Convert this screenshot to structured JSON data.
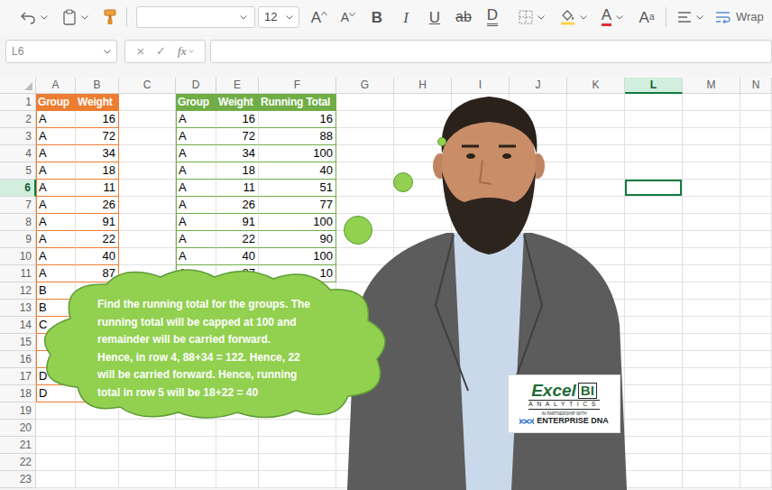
{
  "toolbar": {
    "font_name": "",
    "font_size": "12",
    "grow_font": "A",
    "shrink_font": "A",
    "bold": "B",
    "italic": "I",
    "underline": "U",
    "strikethrough": "ab",
    "double_underline": "D",
    "font_color": "A",
    "text_effects": "A",
    "text_effects_small": "a",
    "wrap": "Wrap"
  },
  "formula_bar": {
    "name_box": "L6",
    "cancel": "×",
    "enter": "✓",
    "function": "fx",
    "content": ""
  },
  "sheet": {
    "columns": [
      {
        "label": "A",
        "selected": false
      },
      {
        "label": "B",
        "selected": false
      },
      {
        "label": "C",
        "selected": false
      },
      {
        "label": "D",
        "selected": false
      },
      {
        "label": "E",
        "selected": false
      },
      {
        "label": "F",
        "selected": false
      },
      {
        "label": "G",
        "selected": false
      },
      {
        "label": "H",
        "selected": false
      },
      {
        "label": "I",
        "selected": false
      },
      {
        "label": "J",
        "selected": false
      },
      {
        "label": "K",
        "selected": false
      },
      {
        "label": "L",
        "selected": true
      },
      {
        "label": "M",
        "selected": false
      },
      {
        "label": "N",
        "selected": false
      }
    ],
    "rows": [
      {
        "label": "1",
        "selected": false
      },
      {
        "label": "2",
        "selected": false
      },
      {
        "label": "3",
        "selected": false
      },
      {
        "label": "4",
        "selected": false
      },
      {
        "label": "5",
        "selected": false
      },
      {
        "label": "6",
        "selected": true
      },
      {
        "label": "7",
        "selected": false
      },
      {
        "label": "8",
        "selected": false
      },
      {
        "label": "9",
        "selected": false
      },
      {
        "label": "10",
        "selected": false
      },
      {
        "label": "11",
        "selected": false
      },
      {
        "label": "12",
        "selected": false
      },
      {
        "label": "13",
        "selected": false
      },
      {
        "label": "14",
        "selected": false
      },
      {
        "label": "15",
        "selected": false
      },
      {
        "label": "16",
        "selected": false
      },
      {
        "label": "17",
        "selected": false
      },
      {
        "label": "18",
        "selected": false
      },
      {
        "label": "19",
        "selected": false
      },
      {
        "label": "20",
        "selected": false
      },
      {
        "label": "21",
        "selected": false
      },
      {
        "label": "22",
        "selected": false
      },
      {
        "label": "23",
        "selected": false
      }
    ],
    "tables": [
      {
        "color": "#ED7D31",
        "columns": [
          "Group",
          "Weight"
        ],
        "rows": [
          [
            "A",
            "16"
          ],
          [
            "A",
            "72"
          ],
          [
            "A",
            "34"
          ],
          [
            "A",
            "18"
          ],
          [
            "A",
            "11"
          ],
          [
            "A",
            "26"
          ],
          [
            "A",
            "91"
          ],
          [
            "A",
            "22"
          ],
          [
            "A",
            "40"
          ],
          [
            "A",
            "87"
          ],
          [
            "B",
            ""
          ],
          [
            "B",
            ""
          ],
          [
            "C",
            ""
          ],
          [
            "",
            ""
          ],
          [
            "",
            ""
          ],
          [
            "D",
            ""
          ],
          [
            "D",
            ""
          ]
        ]
      },
      {
        "color": "#70AD47",
        "columns": [
          "Group",
          "Weight",
          "Running Total"
        ],
        "rows": [
          [
            "A",
            "16",
            "16"
          ],
          [
            "A",
            "72",
            "88"
          ],
          [
            "A",
            "34",
            "100"
          ],
          [
            "A",
            "18",
            "40"
          ],
          [
            "A",
            "11",
            "51"
          ],
          [
            "A",
            "26",
            "77"
          ],
          [
            "A",
            "91",
            "100"
          ],
          [
            "A",
            "22",
            "90"
          ],
          [
            "A",
            "40",
            "100"
          ],
          [
            "A",
            "87",
            "10"
          ]
        ]
      }
    ]
  },
  "callout": {
    "lines": [
      "Find the running total for the groups. The",
      "running total will be capped at 100 and",
      "remainder will be carried forward.",
      "Hence, in row 4, 88+34 = 122. Hence, 22",
      "will be carried forward. Hence, running",
      "total in row 5 will be 18+22 = 40"
    ]
  },
  "logo": {
    "word": "Excel",
    "mark": "BI",
    "sub": "ANALYTICS",
    "partner": "IN PARTNERSHIP WITH",
    "brand": "ENTERPRISE DNA"
  }
}
